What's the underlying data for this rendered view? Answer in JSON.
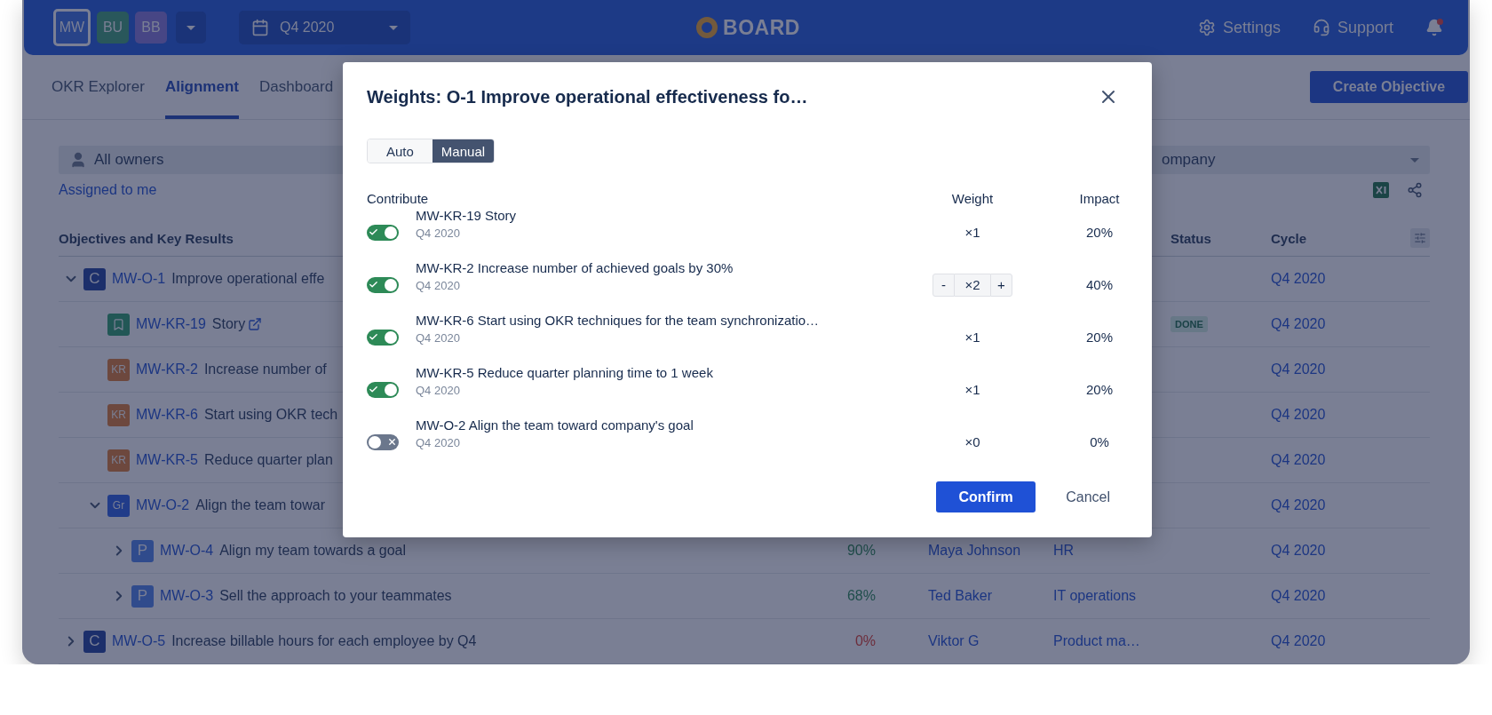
{
  "top_bar": {
    "workspaces": [
      {
        "label": "MW",
        "selected": true,
        "color": "#284388"
      },
      {
        "label": "BU",
        "selected": false,
        "color": "#29575b"
      },
      {
        "label": "BB",
        "selected": false,
        "color": "#474685"
      }
    ],
    "period": "Q4 2020",
    "logo": "BOARD",
    "links": [
      {
        "kind": "settings",
        "label": "Settings"
      },
      {
        "kind": "support",
        "label": "Support"
      }
    ],
    "notifications_unread": true
  },
  "nav": {
    "tabs": [
      {
        "label": "OKR Explorer",
        "selected": false
      },
      {
        "label": "Alignment",
        "selected": true
      },
      {
        "label": "Dashboard",
        "selected": false
      }
    ],
    "create_button": "Create Objective"
  },
  "filters": {
    "owner": "All owners",
    "company": "ompany",
    "assigned_link": "Assigned to me"
  },
  "table": {
    "columns": {
      "title": "Objectives and Key Results",
      "status": "Status",
      "cycle": "Cycle"
    },
    "rows": [
      {
        "key": "MW-O-1",
        "title": "Improve operational effe",
        "kind": "letter",
        "badge": "C",
        "color": "#1c2f6b",
        "expanded": true,
        "cycle": "Q4 2020",
        "children": [
          {
            "key": "MW-KR-19",
            "title": "Story",
            "kind": "story",
            "color": "#225756",
            "has_link": true,
            "status": "DONE",
            "cycle": "Q4 2020"
          },
          {
            "key": "MW-KR-2",
            "title": "Increase number of",
            "kind": "letter",
            "badge": "KR",
            "color": "#6d483e",
            "cycle": "Q4 2020"
          },
          {
            "key": "MW-KR-6",
            "title": "Start using OKR tech",
            "kind": "letter",
            "badge": "KR",
            "color": "#6d483e",
            "cycle": "Q4 2020"
          },
          {
            "key": "MW-KR-5",
            "title": "Reduce quarter plan",
            "kind": "letter",
            "badge": "KR",
            "color": "#6d483e",
            "cycle": "Q4 2020"
          },
          {
            "key": "MW-O-2",
            "title": "Align the team towar",
            "kind": "letter",
            "badge": "Gr",
            "color": "#213c89",
            "expanded": true,
            "cycle": "Q4 2020",
            "children": [
              {
                "key": "MW-O-4",
                "title": "Align my team towards a goal",
                "kind": "letter",
                "badge": "P",
                "color": "#304b8c",
                "expanded": false,
                "progress": "90%",
                "on_track": true,
                "owner": "Maya Johnson",
                "team": "HR",
                "cycle": "Q4 2020"
              },
              {
                "key": "MW-O-3",
                "title": "Sell the approach to your teammates",
                "kind": "letter",
                "badge": "P",
                "color": "#304b8c",
                "expanded": false,
                "progress": "68%",
                "on_track": true,
                "owner": "Ted Baker",
                "team": "IT operations",
                "cycle": "Q4 2020"
              }
            ]
          }
        ]
      },
      {
        "key": "MW-O-5",
        "title": "Increase billable hours for each employee by Q4",
        "kind": "letter",
        "badge": "C",
        "color": "#1c2f6b",
        "expanded": false,
        "progress": "0%",
        "on_track": false,
        "owner": "Viktor G",
        "team": "Product ma…",
        "cycle": "Q4 2020"
      }
    ]
  },
  "modal": {
    "title": "Weights: O-1 Improve operational effectiveness fo…",
    "modes": [
      {
        "label": "Auto",
        "selected": false
      },
      {
        "label": "Manual",
        "selected": true
      }
    ],
    "columns": {
      "contribute": "Contribute",
      "weight": "Weight",
      "impact": "Impact"
    },
    "items": [
      {
        "kind": "fixed",
        "name": "MW-KR-19 Story",
        "cycle": "Q4 2020",
        "contributes": true,
        "weight": "×1",
        "impact": "20%"
      },
      {
        "kind": "stepper",
        "name": "MW-KR-2 Increase number of achieved goals by 30%",
        "cycle": "Q4 2020",
        "contributes": true,
        "decrement": "-",
        "weight": "×2",
        "increment": "+",
        "impact": "40%"
      },
      {
        "kind": "fixed",
        "name": "MW-KR-6 Start using OKR techniques for the team synchronizatio…",
        "cycle": "Q4 2020",
        "contributes": true,
        "weight": "×1",
        "impact": "20%"
      },
      {
        "kind": "fixed",
        "name": "MW-KR-5 Reduce quarter planning time to 1 week",
        "cycle": "Q4 2020",
        "contributes": true,
        "weight": "×1",
        "impact": "20%"
      },
      {
        "kind": "fixed",
        "name": "MW-O-2 Align the team toward company's goal",
        "cycle": "Q4 2020",
        "contributes": false,
        "weight": "×0",
        "impact": "0%"
      }
    ],
    "confirm": "Confirm",
    "cancel": "Cancel"
  }
}
